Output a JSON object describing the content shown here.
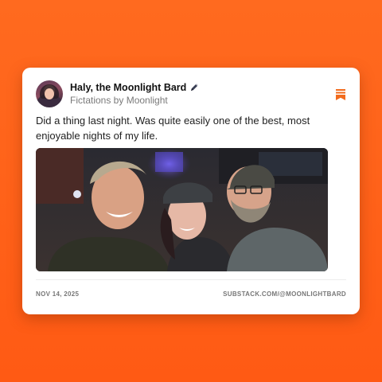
{
  "colors": {
    "background": "#ff5f17",
    "card": "#ffffff",
    "accent": "#f26b1d",
    "author_text": "#111111",
    "secondary_text": "#7a7a7a"
  },
  "post": {
    "author_name": "Haly, the Moonlight Bard",
    "author_badge_icon": "pen-nib-icon",
    "publication": "Fictations by Moonlight",
    "body": "Did a thing last night. Was quite easily one of the best, most enjoyable nights of my life.",
    "bookmark_icon": "substack-bookmark-icon",
    "photo_icon": "group-selfie-photo"
  },
  "footer": {
    "date": "NOV 14, 2025",
    "link": "SUBSTACK.COM/@MOONLIGHTBARD"
  }
}
